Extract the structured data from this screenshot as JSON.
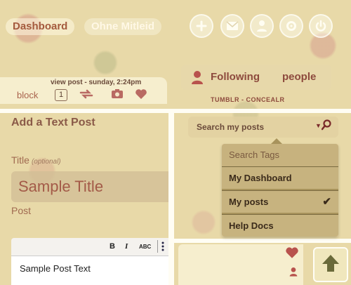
{
  "nav": {
    "dashboard_label": "Dashboard",
    "blog_label": "Ohne Mitleid",
    "icons": [
      "plus-icon",
      "mail-icon",
      "user-icon",
      "gear-icon",
      "power-icon"
    ]
  },
  "subpanel": {
    "block_label": "block",
    "viewpost_label": "view post - sunday, 2:24pm",
    "count": "1"
  },
  "following": {
    "label": "Following",
    "people_label": "people",
    "footer": "TUMBLR - CONCEALR"
  },
  "text_post": {
    "heading": "Add a Text Post",
    "title_label": "Title",
    "title_optional": "(optional)",
    "title_value": "Sample Title",
    "post_label": "Post",
    "toolbar": {
      "bold": "B",
      "italic": "I",
      "strike": "ABC"
    },
    "body_value": "Sample Post Text"
  },
  "search": {
    "placeholder": "Search my posts",
    "menu": [
      {
        "label": "Search Tags",
        "header": true
      },
      {
        "label": "My Dashboard"
      },
      {
        "label": "My posts",
        "checked": true
      },
      {
        "label": "Help Docs"
      }
    ]
  },
  "colors": {
    "accent": "#a45a3d",
    "heart": "#b8524d",
    "background": "#e8d9a8"
  }
}
